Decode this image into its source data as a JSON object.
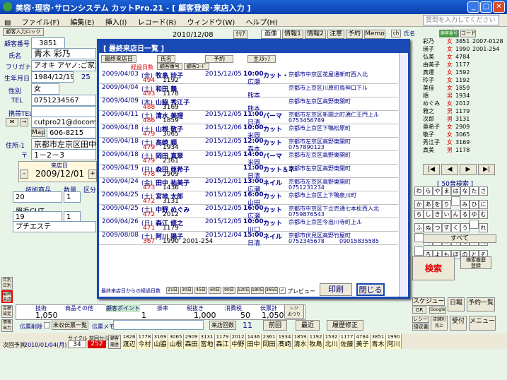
{
  "window": {
    "title": "美容･理容･サロンシステム カットPro.21 - [ 顧客登録･来店入力 ]"
  },
  "menu": [
    "ファイル(F)",
    "編集(E)",
    "挿入(I)",
    "レコード(R)",
    "ウィンドウ(W)",
    "ヘルプ(H)"
  ],
  "help_box": {
    "placeholder": "質問を入力してください"
  },
  "customer": {
    "tag": "顧客入力ロック",
    "number_label": "顧客番号",
    "number": "3851",
    "name_label": "氏名",
    "name": "青木 彩乃",
    "kana_label": "フリガナ",
    "kana": "アオキ アヤノ:ご家族",
    "birth_label": "生年月日",
    "birth": "1984/12/19",
    "age": "25",
    "sex_label": "性別",
    "sex": "女",
    "tel_label": "TEL",
    "tel": "0751234567",
    "mobile_label": "携帯TEL",
    "email": "cutpro21@docomo.ne",
    "map": "Map",
    "zip": "606-8215",
    "address_label": "住所-1",
    "address1": "京都市左京区田中上",
    "address2_label": "〒",
    "address2": "1－2－3",
    "visit_label": "来店日",
    "visit_date": "2009/12/01"
  },
  "header_date": "2010/12/08",
  "clear": "ｸﾘｱ",
  "tabs": [
    "画像",
    "情報1",
    "情報2",
    "注意",
    "予約",
    "Memo"
  ],
  "dialog": {
    "title": "[ 最終来店日一覧 ]",
    "buttons": [
      "最終来店日",
      "氏名",
      "予約",
      "主ｽﾀｯﾌ"
    ],
    "subheaders": [
      "経過日数",
      "顧客番号",
      "顧客ｺｰﾄﾞ"
    ],
    "rows": [
      {
        "date": "2009/04/03",
        "dow": "(金)",
        "name": "牧島 玲子",
        "next": "2015/12/05",
        "time": "10:00",
        "menu": "カット・",
        "addr": "京都市中京区花屋通新町西入北",
        "days": "494",
        "code": "1192",
        "staff": "広瀬",
        "phone": ""
      },
      {
        "date": "2009/04/04",
        "dow": "(土)",
        "name": "和田 舞",
        "next": "",
        "time": "",
        "menu": "",
        "addr": "京都市上京区川原町烏神口下ル",
        "days": "493",
        "code": "1178",
        "staff": "熊本",
        "phone": ""
      },
      {
        "date": "2009/04/09",
        "dow": "(木)",
        "name": "山脇 秀江子",
        "next": "",
        "time": "",
        "menu": "",
        "addr": "京都市左京区高野東開町",
        "days": "488",
        "code": "3169",
        "staff": "熊本",
        "phone": ""
      },
      {
        "date": "2009/04/11",
        "dow": "(土)",
        "name": "清水 美理",
        "next": "2015/12/05",
        "time": "11:00",
        "menu": "パーマ",
        "addr": "京都市左京区新間之町通仁王門上ル",
        "days": "486",
        "code": "1859",
        "staff": "日清",
        "phone": "0753456789"
      },
      {
        "date": "2009/04/18",
        "dow": "(土)",
        "name": "山根 敬子",
        "next": "2015/12/06",
        "time": "10:00",
        "menu": "カット",
        "addr": "京都市上京区下鴨松原町",
        "days": "479",
        "code": "3065",
        "staff": "米岡",
        "phone": ""
      },
      {
        "date": "2009/04/18",
        "dow": "(土)",
        "name": "髙崎 順",
        "next": "2015/12/05",
        "time": "12:00",
        "menu": "カット",
        "addr": "京都市左京区高野東開町",
        "days": "479",
        "code": "1934",
        "staff": "森本",
        "phone": "0757890123"
      },
      {
        "date": "2009/04/18",
        "dow": "(土)",
        "name": "岡田 真翠",
        "next": "2015/12/05",
        "time": "14:00",
        "menu": "パーマ",
        "addr": "京都市左京区高野東開町",
        "days": "479",
        "code": "2361",
        "staff": "米岡",
        "phone": ""
      },
      {
        "date": "2009/04/19",
        "dow": "(日)",
        "name": "森田 亜希子",
        "next": "",
        "time": "11:00",
        "menu": "カット＆ネ",
        "addr": "京都市左京区高野東開町",
        "days": "478",
        "code": "2909",
        "staff": "日清",
        "phone": ""
      },
      {
        "date": "2009/04/24",
        "dow": "(金)",
        "name": "田中 祐美子",
        "next": "2015/12/01",
        "time": "13:00",
        "menu": "ネイル",
        "addr": "京都市左京区高野東開町",
        "days": "473",
        "code": "1436",
        "staff": "広瀬",
        "phone": "0751231234"
      },
      {
        "date": "2009/04/25",
        "dow": "(土)",
        "name": "宮地 太郎",
        "next": "2015/12/05",
        "time": "16:00",
        "menu": "カット",
        "addr": "京都市上京区上下鴨泉川町",
        "days": "472",
        "code": "3131",
        "staff": "山田",
        "phone": ""
      },
      {
        "date": "2009/04/25",
        "dow": "(土)",
        "name": "中野 めぐみ",
        "next": "2015/12/05",
        "time": "16:00",
        "menu": "カット",
        "addr": "京都市中京区下立売通七本松西入北",
        "days": "472",
        "code": "2012",
        "staff": "広瀬",
        "phone": "0759876543"
      },
      {
        "date": "2009/04/26",
        "dow": "(日)",
        "name": "森江 修之",
        "next": "2015/12/05",
        "time": "10:00",
        "menu": "カット",
        "addr": "京都市上京区今出川寺町上ル",
        "days": "471",
        "code": "1179",
        "staff": "川口",
        "phone": ""
      },
      {
        "date": "2009/08/08",
        "dow": "(土)",
        "name": "阿川 陽子",
        "next": "2015/12/04",
        "time": "15:00",
        "menu": "ネイル",
        "addr": "京都市伏見区高野竹屋町",
        "days": "367",
        "code": "1990",
        "code2": "2001-254",
        "staff": "日清",
        "phone": "0752345678",
        "phone2": "09015835585"
      }
    ],
    "footer_label": "最終来店日からの経過日数",
    "footer_days": [
      "21日",
      "30日",
      "45日",
      "60日",
      "90日",
      "120日",
      "180日",
      "365日"
    ],
    "preview": "プレビュー",
    "print": "印刷",
    "close": "閉じる"
  },
  "right_header": {
    "ch": "ch",
    "name_label": "氏名",
    "code_btn": "顧客番号",
    "code2_btn": "コード"
  },
  "right_list": [
    {
      "name": "彩乃",
      "sex": "女",
      "num": "3851",
      "extra": "2007-0128"
    },
    {
      "name": "瑛子",
      "sex": "女",
      "num": "1990",
      "extra": "2001-254"
    },
    {
      "name": "弘美",
      "sex": "女",
      "num": "4784",
      "extra": ""
    },
    {
      "name": "由美子",
      "sex": "女",
      "num": "1177",
      "extra": ""
    },
    {
      "name": "真運",
      "sex": "女",
      "num": "1592",
      "extra": ""
    },
    {
      "name": "玲子",
      "sex": "女",
      "num": "1192",
      "extra": ""
    },
    {
      "name": "美佳",
      "sex": "女",
      "num": "1859",
      "extra": ""
    },
    {
      "name": "順",
      "sex": "男",
      "num": "1934",
      "extra": ""
    },
    {
      "name": "めぐみ",
      "sex": "女",
      "num": "2012",
      "extra": ""
    },
    {
      "name": "雅之",
      "sex": "男",
      "num": "1179",
      "extra": ""
    },
    {
      "name": "次郎",
      "sex": "男",
      "num": "3131",
      "extra": ""
    },
    {
      "name": "亜希子",
      "sex": "女",
      "num": "2909",
      "extra": ""
    },
    {
      "name": "敬子",
      "sex": "女",
      "num": "3065",
      "extra": ""
    },
    {
      "name": "秀江子",
      "sex": "女",
      "num": "3169",
      "extra": ""
    },
    {
      "name": "真美",
      "sex": "男",
      "num": "1178",
      "extra": ""
    }
  ],
  "nav": [
    "|◀",
    "◀",
    "▶",
    "▶|"
  ],
  "kana_title": "[ 50音検索 ]",
  "kana_chars": [
    "わ",
    "ら",
    "や",
    "ま",
    "は",
    "な",
    "た",
    "さ",
    "か",
    "あ",
    "を",
    "り",
    "",
    "み",
    "ひ",
    "に",
    "ち",
    "し",
    "き",
    "い",
    "ん",
    "る",
    "ゆ",
    "む",
    "ふ",
    "ぬ",
    "つ",
    "す",
    "く",
    "う",
    "",
    "れ",
    "",
    "め",
    "へ",
    "ね",
    "て",
    "せ",
    "け",
    "え",
    "",
    "ろ",
    "よ",
    "も",
    "ほ",
    "の",
    "と",
    "そ",
    "こ",
    "お"
  ],
  "kana_all": "すべて",
  "search_btn": "検索",
  "history_btn": "検索履歴\n登録",
  "right_buttons": [
    "スケジュール",
    "日報",
    "予約一覧",
    "OR",
    "",
    "Google",
    "レシート",
    "領収書",
    "店舗別\n売上",
    "受付",
    "メニュー"
  ],
  "left_panel": {
    "tech_label": "技術商品",
    "qty_label": "数量",
    "unit_label": "区分",
    "line1": "20",
    "line1_qty": "1",
    "line2": "眉毛CUT",
    "line3": "19",
    "line3_qty": "1",
    "line4": "プチエステ",
    "side_btns": [
      "月別\n日別",
      "最終\n来店",
      "金額\n設定",
      "情報\n出力"
    ]
  },
  "summary": {
    "tech_label": "技術",
    "product_label": "商品その他",
    "point_label": "顧客ポイント",
    "rate_label": "掛率",
    "tax_excl_label": "税抜き",
    "tax_label": "消費税",
    "total_label": "伝票計",
    "register": "レジ\nおつり",
    "tech_value": "1,050",
    "point_value": "1",
    "tax_excl_value": "1,000",
    "tax_value": "50",
    "total_value": "1,050",
    "delete_label": "伝票削除",
    "unissued": "未収伝票一覧",
    "memo_label": "伝票メモ",
    "visits_label": "来店回数",
    "visits": "11",
    "prev": "前回",
    "latest": "最近",
    "history_fix": "履歴修正"
  },
  "bottom": {
    "next_label": "次回予測",
    "next_date": "2010/01/04(月)",
    "cycle_label": "サイクル",
    "cycle": "34",
    "elapsed_label": "前回から",
    "elapsed": "252",
    "card": "顧客\n履歴",
    "history": [
      {
        "num": "1826",
        "name": "渡辺"
      },
      {
        "num": "1778",
        "name": "今村"
      },
      {
        "num": "3169",
        "name": "山脇"
      },
      {
        "num": "3065",
        "name": "山根"
      },
      {
        "num": "2909",
        "name": "森田"
      },
      {
        "num": "3131",
        "name": "宮地"
      },
      {
        "num": "1179",
        "name": "森江"
      },
      {
        "num": "2012",
        "name": "中野"
      },
      {
        "num": "1436",
        "name": "田中"
      },
      {
        "num": "2361",
        "name": "岡田"
      },
      {
        "num": "1934",
        "name": "髙崎"
      },
      {
        "num": "1859",
        "name": "清水"
      },
      {
        "num": "1192",
        "name": "牧島"
      },
      {
        "num": "1592",
        "name": "北川"
      },
      {
        "num": "1177",
        "name": "佐藤"
      },
      {
        "num": "4784",
        "name": "美子"
      },
      {
        "num": "3851",
        "name": "青木"
      },
      {
        "num": "1990",
        "name": "阿川"
      }
    ]
  },
  "colors": {
    "title": "#0a3fae",
    "dialog_border": "#1849b5",
    "accent_red": "#d00000"
  }
}
